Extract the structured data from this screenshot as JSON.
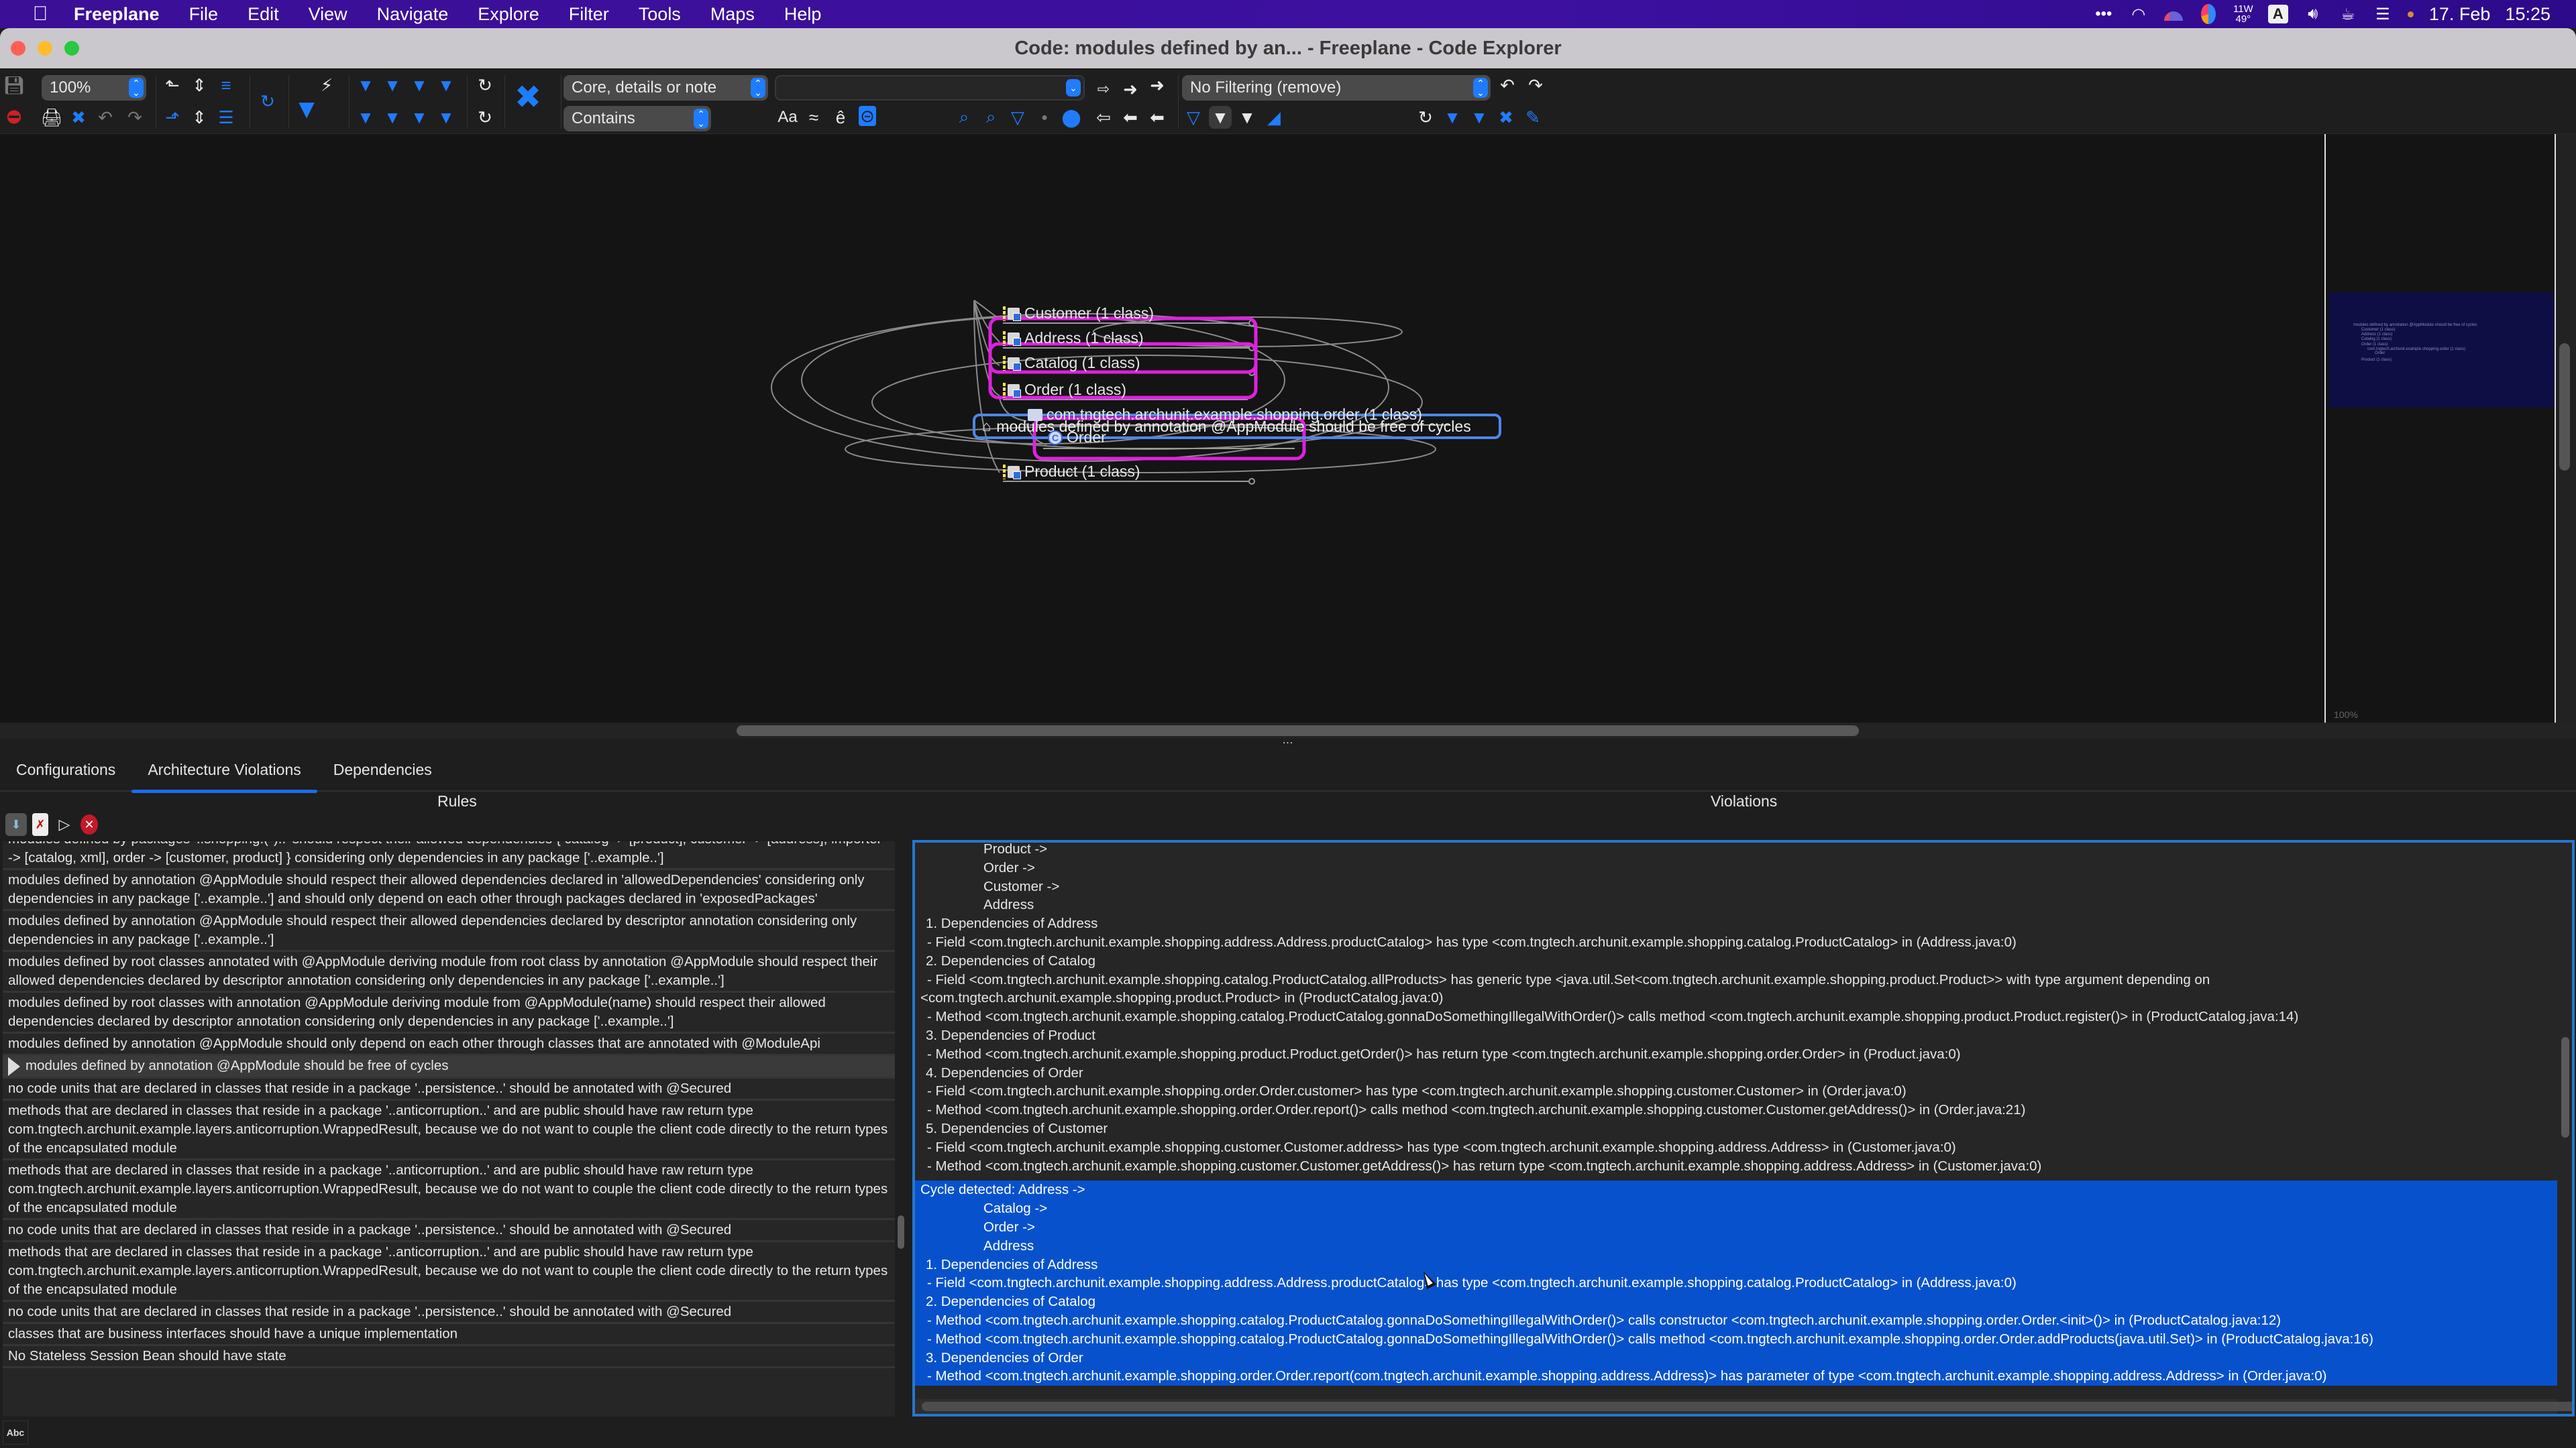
{
  "menubar": {
    "apple_icon": "apple-logo",
    "app_name": "Freeplane",
    "items": [
      "File",
      "Edit",
      "View",
      "Navigate",
      "Explore",
      "Filter",
      "Tools",
      "Maps",
      "Help"
    ],
    "tray": {
      "more_icon": "ellipsis-icon",
      "wifi_icon": "wifi-icon",
      "weather_top": "11W",
      "weather_bottom": "49°",
      "input_source": "A",
      "date": "17. Feb",
      "time": "15:25"
    }
  },
  "window": {
    "title": "Code: modules defined by an... - Freeplane - Code Explorer"
  },
  "toolbar": {
    "zoom_value": "100%",
    "search_scope": "Core, details or note",
    "search_mode": "Contains",
    "search_query": "",
    "filter_value": "No Filtering (remove)",
    "match_case_label": "Aa",
    "approx_label": "≈",
    "accents_label": "ê"
  },
  "mindmap": {
    "root": "modules defined by annotation @AppModule should be free of cycles",
    "nodes": [
      {
        "label": "Customer (1 class)"
      },
      {
        "label": "Address (1 class)"
      },
      {
        "label": "Catalog (1 class)"
      },
      {
        "label": "Order (1 class)"
      },
      {
        "label": "com.tngtech.archunit.example.shopping.order (1 class)"
      },
      {
        "label": "Order"
      },
      {
        "label": "Product (1 class)"
      }
    ],
    "highlight_color": "#e020e0",
    "connector_color": "#8a8a8a"
  },
  "minimap": {
    "zoom_label": "100%",
    "root": "modules defined by annotation @AppModule should be free of cycles",
    "nodes": [
      "Customer (1 class)",
      "Address (1 class)",
      "Catalog (1 class)",
      "Order (1 class)",
      "com.tngtech.archunit.example.shopping.order (1 class)",
      "Order",
      "Product (1 class)"
    ]
  },
  "tabs": [
    {
      "label": "Configurations",
      "active": false
    },
    {
      "label": "Architecture Violations",
      "active": true
    },
    {
      "label": "Dependencies",
      "active": false
    }
  ],
  "rules_panel": {
    "header": "Rules",
    "rules": [
      {
        "text": "modules defined by packages '..shopping.(*)..' should respect their allowed dependencies { catalog -> [product], customer -> [address], importer -> [catalog, xml], order -> [customer, product] } considering only dependencies in any package ['..example..']",
        "selected": false
      },
      {
        "text": "modules defined by annotation @AppModule should respect their allowed dependencies declared in 'allowedDependencies' considering only dependencies in any package ['..example..'] and should only depend on each other through packages declared in 'exposedPackages'",
        "selected": false
      },
      {
        "text": "modules defined by annotation @AppModule should respect their allowed dependencies declared by descriptor annotation considering only dependencies in any package ['..example..']",
        "selected": false
      },
      {
        "text": "modules defined by root classes annotated with @AppModule deriving module from root class by annotation @AppModule should respect their allowed dependencies declared by descriptor annotation considering only dependencies in any package ['..example..']",
        "selected": false
      },
      {
        "text": "modules defined by root classes with annotation @AppModule deriving module from @AppModule(name) should respect their allowed dependencies declared by descriptor annotation considering only dependencies in any package ['..example..']",
        "selected": false
      },
      {
        "text": "modules defined by annotation @AppModule should only depend on each other through classes that are annotated with @ModuleApi",
        "selected": false
      },
      {
        "text": "modules defined by annotation @AppModule should be free of cycles",
        "selected": true
      },
      {
        "text": "no code units that are declared in classes that reside in a package '..persistence..' should be annotated with @Secured",
        "selected": false
      },
      {
        "text": "methods that are declared in classes that reside in a package '..anticorruption..' and are public should have raw return type com.tngtech.archunit.example.layers.anticorruption.WrappedResult, because we do not want to couple the client code directly to the return types of the encapsulated module",
        "selected": false
      },
      {
        "text": "methods that are declared in classes that reside in a package '..anticorruption..' and are public should have raw return type com.tngtech.archunit.example.layers.anticorruption.WrappedResult, because we do not want to couple the client code directly to the return types of the encapsulated module",
        "selected": false
      },
      {
        "text": "no code units that are declared in classes that reside in a package '..persistence..' should be annotated with @Secured",
        "selected": false
      },
      {
        "text": "methods that are declared in classes that reside in a package '..anticorruption..' and are public should have raw return type com.tngtech.archunit.example.layers.anticorruption.WrappedResult, because we do not want to couple the client code directly to the return types of the encapsulated module",
        "selected": false
      },
      {
        "text": "no code units that are declared in classes that reside in a package '..persistence..' should be annotated with @Secured",
        "selected": false
      },
      {
        "text": "classes that are business interfaces should have a unique implementation",
        "selected": false
      },
      {
        "text": "No Stateless Session Bean should have state",
        "selected": false
      }
    ]
  },
  "violations_panel": {
    "header": "Violations",
    "blocks": [
      {
        "selected": false,
        "lines": [
          {
            "kind": "indent",
            "text": "Product ->"
          },
          {
            "kind": "indent",
            "text": "Order ->"
          },
          {
            "kind": "indent",
            "text": "Customer ->"
          },
          {
            "kind": "indent",
            "text": "Address"
          },
          {
            "kind": "dep",
            "text": "1. Dependencies of Address"
          },
          {
            "kind": "sub",
            "text": "- Field <com.tngtech.archunit.example.shopping.address.Address.productCatalog> has type <com.tngtech.archunit.example.shopping.catalog.ProductCatalog> in (Address.java:0)"
          },
          {
            "kind": "dep",
            "text": "2. Dependencies of Catalog"
          },
          {
            "kind": "sub",
            "text": "- Field <com.tngtech.archunit.example.shopping.catalog.ProductCatalog.allProducts> has generic type <java.util.Set<com.tngtech.archunit.example.shopping.product.Product>> with type argument depending on"
          },
          {
            "kind": "wrap",
            "text": "<com.tngtech.archunit.example.shopping.product.Product> in (ProductCatalog.java:0)"
          },
          {
            "kind": "sub",
            "text": "- Method <com.tngtech.archunit.example.shopping.catalog.ProductCatalog.gonnaDoSomethingIllegalWithOrder()> calls method <com.tngtech.archunit.example.shopping.product.Product.register()> in (ProductCatalog.java:14)"
          },
          {
            "kind": "dep",
            "text": "3. Dependencies of Product"
          },
          {
            "kind": "sub",
            "text": "- Method <com.tngtech.archunit.example.shopping.product.Product.getOrder()> has return type <com.tngtech.archunit.example.shopping.order.Order> in (Product.java:0)"
          },
          {
            "kind": "dep",
            "text": "4. Dependencies of Order"
          },
          {
            "kind": "sub",
            "text": "- Field <com.tngtech.archunit.example.shopping.order.Order.customer> has type <com.tngtech.archunit.example.shopping.customer.Customer> in (Order.java:0)"
          },
          {
            "kind": "sub",
            "text": "- Method <com.tngtech.archunit.example.shopping.order.Order.report()> calls method <com.tngtech.archunit.example.shopping.customer.Customer.getAddress()> in (Order.java:21)"
          },
          {
            "kind": "dep",
            "text": "5. Dependencies of Customer"
          },
          {
            "kind": "sub",
            "text": "- Field <com.tngtech.archunit.example.shopping.customer.Customer.address> has type <com.tngtech.archunit.example.shopping.address.Address> in (Customer.java:0)"
          },
          {
            "kind": "sub",
            "text": "- Method <com.tngtech.archunit.example.shopping.customer.Customer.getAddress()> has return type <com.tngtech.archunit.example.shopping.address.Address> in (Customer.java:0)"
          }
        ]
      },
      {
        "selected": true,
        "lines": [
          {
            "kind": "wrap",
            "text": "Cycle detected: Address ->"
          },
          {
            "kind": "indent",
            "text": "Catalog ->"
          },
          {
            "kind": "indent",
            "text": "Order ->"
          },
          {
            "kind": "indent",
            "text": "Address"
          },
          {
            "kind": "dep",
            "text": "1. Dependencies of Address"
          },
          {
            "kind": "sub",
            "text": "- Field <com.tngtech.archunit.example.shopping.address.Address.productCatalog> has type <com.tngtech.archunit.example.shopping.catalog.ProductCatalog> in (Address.java:0)"
          },
          {
            "kind": "dep",
            "text": "2. Dependencies of Catalog"
          },
          {
            "kind": "sub",
            "text": "- Method <com.tngtech.archunit.example.shopping.catalog.ProductCatalog.gonnaDoSomethingIllegalWithOrder()> calls constructor <com.tngtech.archunit.example.shopping.order.Order.<init>()> in (ProductCatalog.java:12)"
          },
          {
            "kind": "sub",
            "text": "- Method <com.tngtech.archunit.example.shopping.catalog.ProductCatalog.gonnaDoSomethingIllegalWithOrder()> calls method <com.tngtech.archunit.example.shopping.order.Order.addProducts(java.util.Set)> in (ProductCatalog.java:16)"
          },
          {
            "kind": "dep",
            "text": "3. Dependencies of Order"
          },
          {
            "kind": "sub",
            "text": "- Method <com.tngtech.archunit.example.shopping.order.Order.report(com.tngtech.archunit.example.shopping.address.Address)> has parameter of type <com.tngtech.archunit.example.shopping.address.Address> in (Order.java:0)"
          }
        ]
      }
    ]
  },
  "statusbar": {
    "indicator": "Abc"
  }
}
